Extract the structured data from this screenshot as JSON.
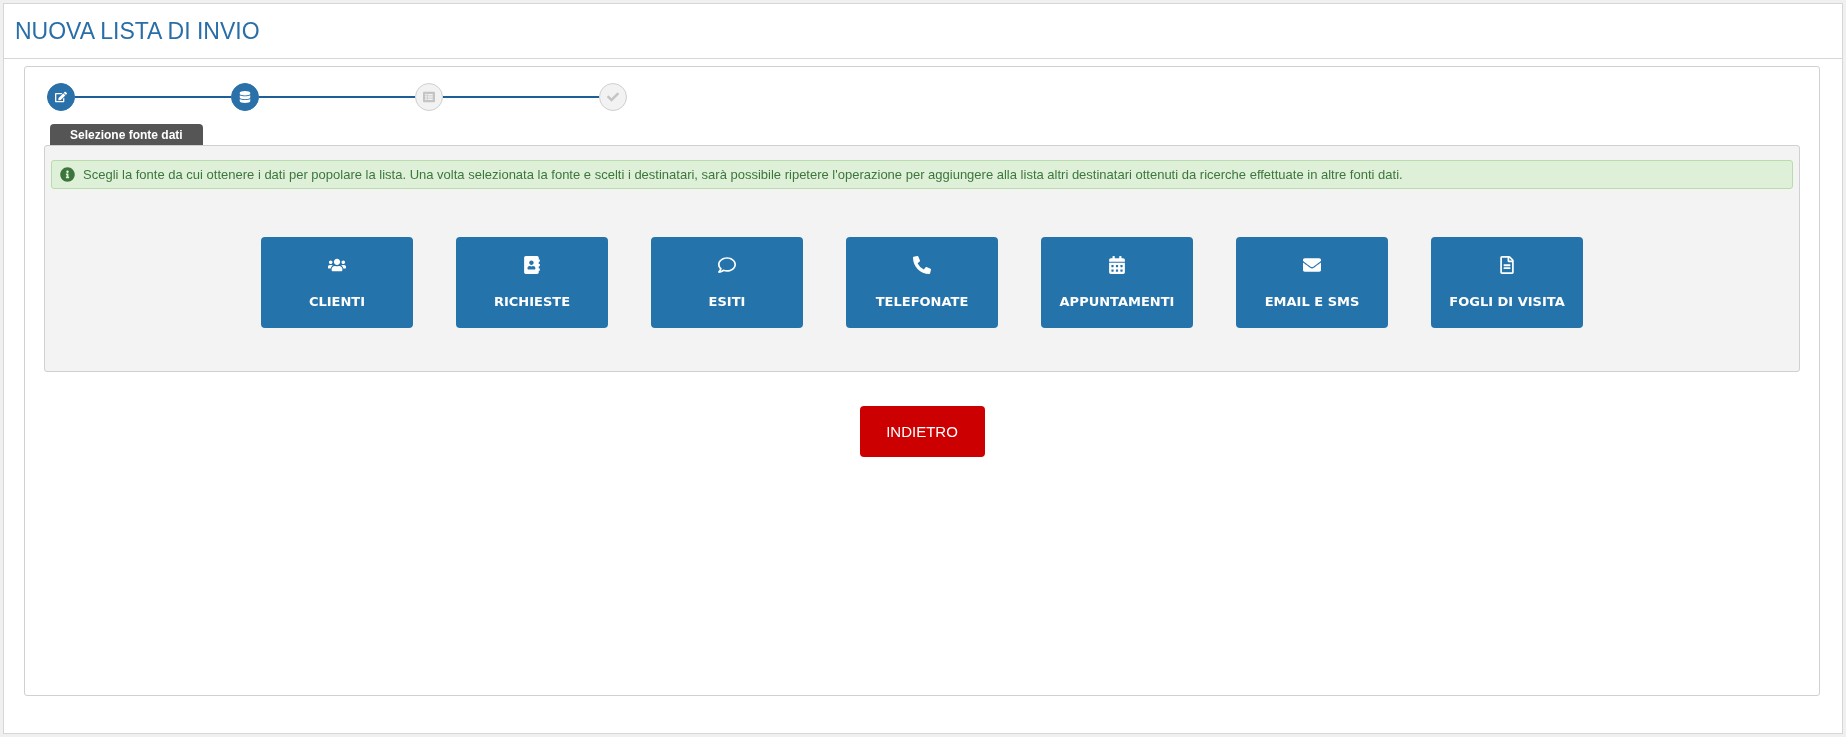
{
  "title": "NUOVA LISTA DI INVIO",
  "steps": [
    {
      "kind": "edit",
      "completed": true
    },
    {
      "kind": "database",
      "completed": true
    },
    {
      "kind": "list",
      "completed": false
    },
    {
      "kind": "check",
      "completed": false
    }
  ],
  "tab": {
    "label": "Selezione fonte dati"
  },
  "info": "Scegli la fonte da cui ottenere i dati per popolare la lista. Una volta selezionata la fonte e scelti i destinatari, sarà possibile ripetere l'operazione per aggiungere alla lista altri destinatari ottenuti da ricerche effettuate in altre fonti dati.",
  "sources": [
    {
      "kind": "users",
      "label": "CLIENTI"
    },
    {
      "kind": "addressbook",
      "label": "RICHIESTE"
    },
    {
      "kind": "comment",
      "label": "ESITI"
    },
    {
      "kind": "phone",
      "label": "TELEFONATE"
    },
    {
      "kind": "calendar",
      "label": "APPUNTAMENTI"
    },
    {
      "kind": "envelope",
      "label": "EMAIL E SMS"
    },
    {
      "kind": "file",
      "label": "FOGLI DI VISITA"
    }
  ],
  "back_button": "INDIETRO"
}
